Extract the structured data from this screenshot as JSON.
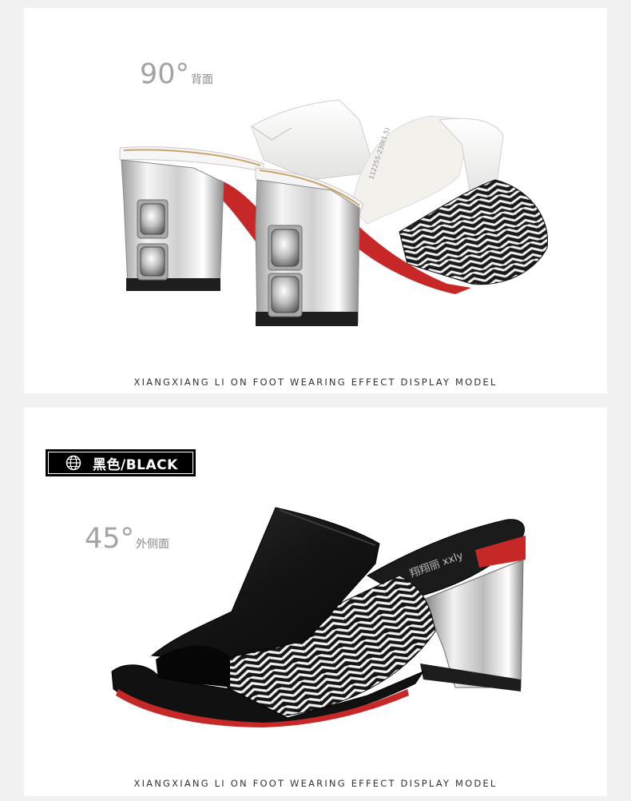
{
  "top_view": {
    "angle": "90°",
    "angle_caption": "背面",
    "insole_print": "112255-230(1.5)",
    "caption": "XIANGXIANG LI ON FOOT WEARING EFFECT DISPLAY MODEL"
  },
  "bottom_view": {
    "color_badge": "黑色/BLACK",
    "angle": "45°",
    "angle_caption": "外侧面",
    "insole_brand": "翔翔丽 xxly",
    "caption": "XIANGXIANG LI ON FOOT WEARING EFFECT DISPLAY MODEL"
  },
  "colors": {
    "background": "#f1f1f1",
    "panel": "#ffffff",
    "leather_white": "#f4f4f2",
    "leather_black": "#151515",
    "pattern_dark": "#1a1a1a",
    "sole_red": "#c62828",
    "heel_chrome": "#d9d9d9",
    "angle_text": "#a3a3a3"
  },
  "icons": [
    "globe-icon",
    "crystal-stud-icon"
  ]
}
